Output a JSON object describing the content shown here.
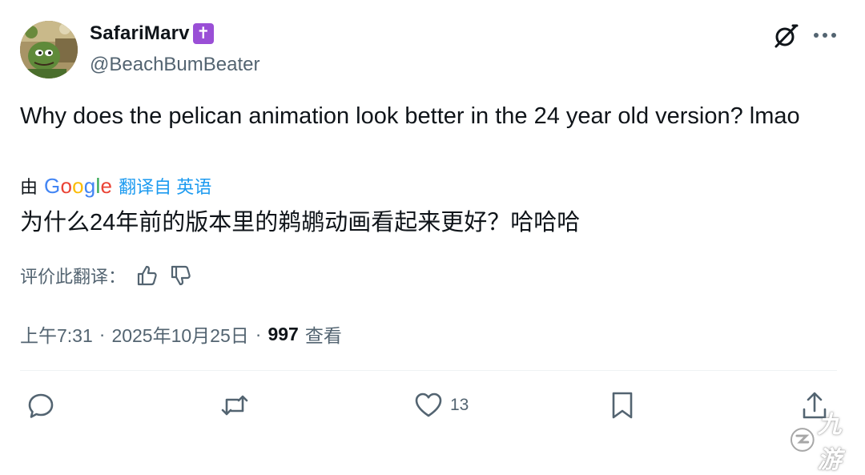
{
  "tweet": {
    "display_name": "SafariMarv",
    "badge_glyph": "✝",
    "handle": "@BeachBumBeater",
    "text": "Why does the pelican animation look better in the 24 year old version? lmao",
    "translation": {
      "by_label": "由",
      "provider": "Google",
      "from_label": "翻译自 英语",
      "translated_text": "为什么24年前的版本里的鹈鹕动画看起来更好？哈哈哈",
      "rate_label": "评价此翻译："
    },
    "meta": {
      "time": "上午7:31",
      "separator": "·",
      "date": "2025年10月25日",
      "views_count": "997",
      "views_label": "查看"
    },
    "actions": {
      "reply_icon": "reply-icon",
      "retweet_icon": "retweet-icon",
      "like_icon": "heart-icon",
      "like_count": "13",
      "bookmark_icon": "bookmark-icon",
      "share_icon": "share-icon"
    }
  },
  "colors": {
    "text_primary": "#0f1419",
    "text_secondary": "#536471",
    "link": "#1d9bf0",
    "badge": "#9a4fd6",
    "divider": "#eff3f4"
  },
  "watermark": {
    "text": "九游"
  }
}
